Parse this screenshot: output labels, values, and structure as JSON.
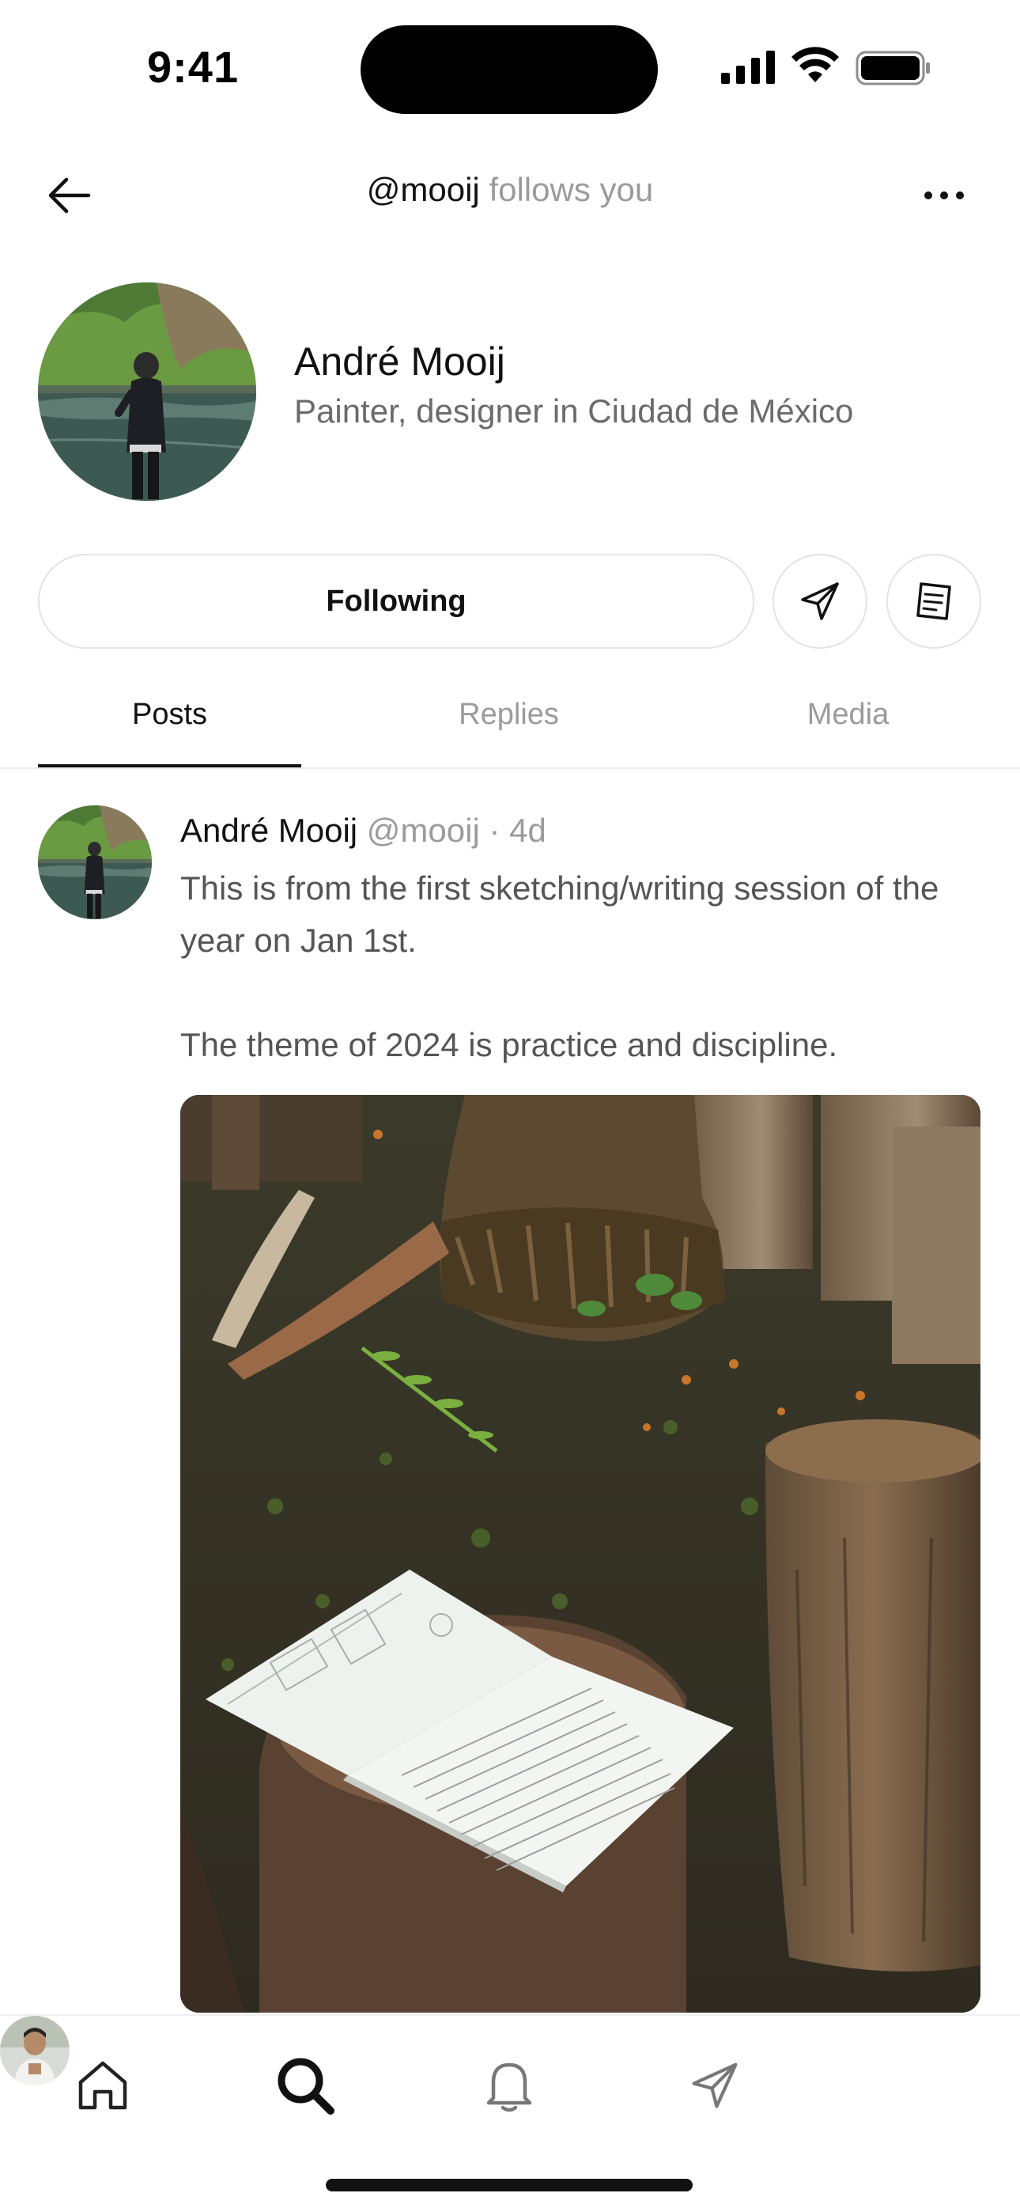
{
  "status_bar": {
    "time": "9:41"
  },
  "header": {
    "handle": "@mooij",
    "subtitle": " follows you",
    "back_icon": "arrow-left-icon",
    "more_icon": "more-horizontal-icon"
  },
  "profile": {
    "name": "André Mooij",
    "bio": "Painter, designer in Ciudad de México",
    "follow_label": "Following",
    "message_icon": "send-icon",
    "notes_icon": "note-icon"
  },
  "tabs": [
    {
      "label": "Posts",
      "active": true
    },
    {
      "label": "Replies",
      "active": false
    },
    {
      "label": "Media",
      "active": false
    }
  ],
  "post": {
    "author": "André Mooij",
    "meta": " @mooij · 4d",
    "paragraphs": [
      "This is from the first sketching/writing session of the year on Jan 1st.",
      "The theme of 2024 is practice and discipline."
    ]
  },
  "nav": {
    "items": [
      "home-icon",
      "search-icon",
      "bell-icon",
      "send-icon",
      "profile-avatar"
    ]
  }
}
